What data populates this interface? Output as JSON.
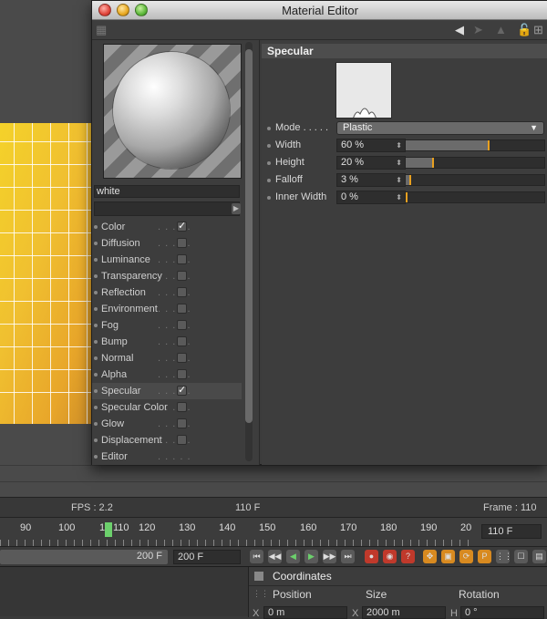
{
  "window": {
    "title": "Material Editor"
  },
  "toolbar": {
    "icons": [
      "arrow-left-icon",
      "arrow-right-icon",
      "arrow-up-icon",
      "lock-icon",
      "new-window-icon"
    ]
  },
  "left": {
    "material_name": "white",
    "channels": [
      {
        "label": "Color",
        "checked": true
      },
      {
        "label": "Diffusion",
        "checked": false
      },
      {
        "label": "Luminance",
        "checked": false
      },
      {
        "label": "Transparency",
        "checked": false
      },
      {
        "label": "Reflection",
        "checked": false
      },
      {
        "label": "Environment",
        "checked": false
      },
      {
        "label": "Fog",
        "checked": false
      },
      {
        "label": "Bump",
        "checked": false
      },
      {
        "label": "Normal",
        "checked": false
      },
      {
        "label": "Alpha",
        "checked": false
      },
      {
        "label": "Specular",
        "checked": true
      },
      {
        "label": "Specular Color",
        "checked": false
      },
      {
        "label": "Glow",
        "checked": false
      },
      {
        "label": "Displacement",
        "checked": false
      },
      {
        "label": "Editor",
        "checked": null
      }
    ]
  },
  "right": {
    "section_title": "Specular",
    "mode": {
      "label": "Mode",
      "value": "Plastic"
    },
    "params": [
      {
        "label": "Width",
        "value": "60 %",
        "level": 0.6
      },
      {
        "label": "Height",
        "value": "20 %",
        "level": 0.2
      },
      {
        "label": "Falloff",
        "value": "3 %",
        "level": 0.03
      },
      {
        "label": "Inner Width",
        "value": "0 %",
        "level": 0.0
      }
    ]
  },
  "status": {
    "fps": "FPS : 2.2",
    "frame_mid": "110 F",
    "frame_right": "Frame : 110"
  },
  "timeline": {
    "ticks": [
      "90",
      "100",
      "1",
      "110",
      "120",
      "130",
      "140",
      "150",
      "160",
      "170",
      "180",
      "190",
      "20"
    ],
    "current": "110 F",
    "start_field": "200 F",
    "end_field": "200 F"
  },
  "coordinates": {
    "title": "Coordinates",
    "col_position": "Position",
    "col_size": "Size",
    "col_rotation": "Rotation",
    "x_label": "X",
    "x_pos": "0 m",
    "x_size_label": "X",
    "x_size": "2000 m",
    "h_label": "H",
    "h_rot": "0 °"
  },
  "colors": {
    "accent_marker": "#e8a020",
    "timeline_cursor": "#6cd06c"
  }
}
